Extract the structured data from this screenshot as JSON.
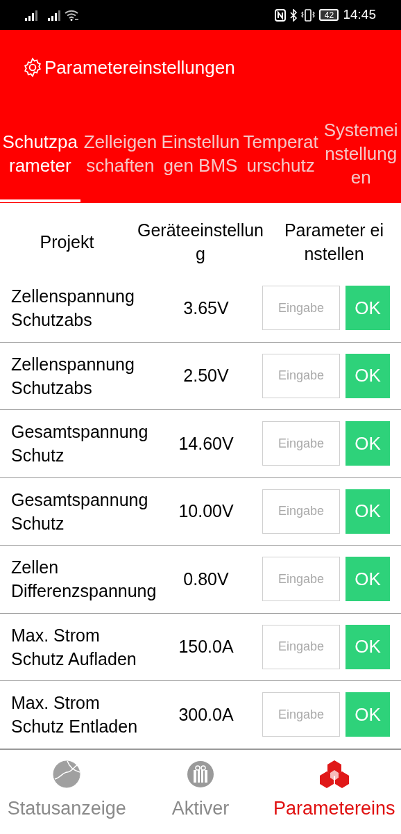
{
  "status_bar": {
    "battery": "42",
    "time": "14:45"
  },
  "header": {
    "title": "Parametereinstellungen"
  },
  "tabs": [
    {
      "label": "Schutzparameter",
      "selected": true
    },
    {
      "label": "Zelleigenschaften",
      "selected": false
    },
    {
      "label": "Einstellungen BMS",
      "selected": false
    },
    {
      "label": "Temperaturschutz",
      "selected": false
    },
    {
      "label": "Systemeinstellungen",
      "selected": false
    }
  ],
  "table": {
    "columns": [
      "Projekt",
      "Geräteeinstellung",
      "Parameter einstellen"
    ],
    "rows": [
      {
        "item": "Zellenspannung Schutzabs",
        "value": "3.65V",
        "placeholder": "Eingabe",
        "button": "OK"
      },
      {
        "item": "Zellenspannung Schutzabs",
        "value": "2.50V",
        "placeholder": "Eingabe",
        "button": "OK"
      },
      {
        "item": "Gesamtspannung Schutz",
        "value": "14.60V",
        "placeholder": "Eingabe",
        "button": "OK"
      },
      {
        "item": "Gesamtspannung Schutz",
        "value": "10.00V",
        "placeholder": "Eingabe",
        "button": "OK"
      },
      {
        "item": "Zellen Differenzspannung",
        "value": "0.80V",
        "placeholder": "Eingabe",
        "button": "OK"
      },
      {
        "item": "Max. Strom Schutz Aufladen",
        "value": "150.0A",
        "placeholder": "Eingabe",
        "button": "OK"
      },
      {
        "item": "Max. Strom Schutz Entladen",
        "value": "300.0A",
        "placeholder": "Eingabe",
        "button": "OK"
      }
    ]
  },
  "bottom_nav": [
    {
      "label": "Statusanzeige",
      "selected": false,
      "kind": "globe"
    },
    {
      "label": "Aktiver",
      "selected": false,
      "kind": "gift"
    },
    {
      "label": "Parametereins",
      "selected": true,
      "kind": "cubes"
    }
  ]
}
